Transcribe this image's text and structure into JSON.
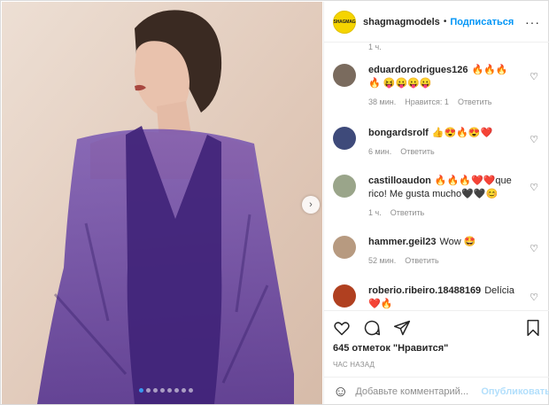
{
  "post": {
    "author": "shagmagmodels",
    "brand_badge": "SHAGMAG",
    "follow_label": "Подписаться",
    "separator": "•",
    "more": "···"
  },
  "carousel": {
    "total": 8,
    "current": 1,
    "next_icon": "chevron-right-icon"
  },
  "top_fragment_time": "1 ч.",
  "comments": [
    {
      "user": "eduardorodrigues126",
      "text": "🔥🔥🔥🔥 😝😛😛😛",
      "time": "38 мин.",
      "likes": "Нравится: 1",
      "reply": "Ответить",
      "avatar_color": "#7a6b5e"
    },
    {
      "user": "bongardsrolf",
      "text": "👍😍🔥😍❤️",
      "time": "6 мин.",
      "likes": "",
      "reply": "Ответить",
      "avatar_color": "#3e4a7a"
    },
    {
      "user": "castilloaudon",
      "text": "🔥🔥🔥❤️❤️que rico! Me gusta mucho🖤🖤😊",
      "time": "1 ч.",
      "likes": "",
      "reply": "Ответить",
      "avatar_color": "#9aa58a"
    },
    {
      "user": "hammer.geil23",
      "text": "Wow 🤩",
      "time": "52 мин.",
      "likes": "",
      "reply": "Ответить",
      "avatar_color": "#b79a80"
    },
    {
      "user": "roberio.ribeiro.18488169",
      "text": "Delícia ❤️🔥",
      "time": "",
      "likes": "",
      "reply": "",
      "avatar_color": "#b04020"
    }
  ],
  "actions": {
    "like_icon": "heart-icon",
    "comment_icon": "comment-icon",
    "share_icon": "share-icon",
    "save_icon": "bookmark-icon",
    "likes_text": "645 отметок \"Нравится\"",
    "time_ago": "ЧАС НАЗАД"
  },
  "composer": {
    "placeholder": "Добавьте комментарий...",
    "post_label": "Опубликовать"
  },
  "colors": {
    "accent": "#0095f6",
    "muted": "#8e8e8e",
    "dress": "#4b2a85"
  }
}
